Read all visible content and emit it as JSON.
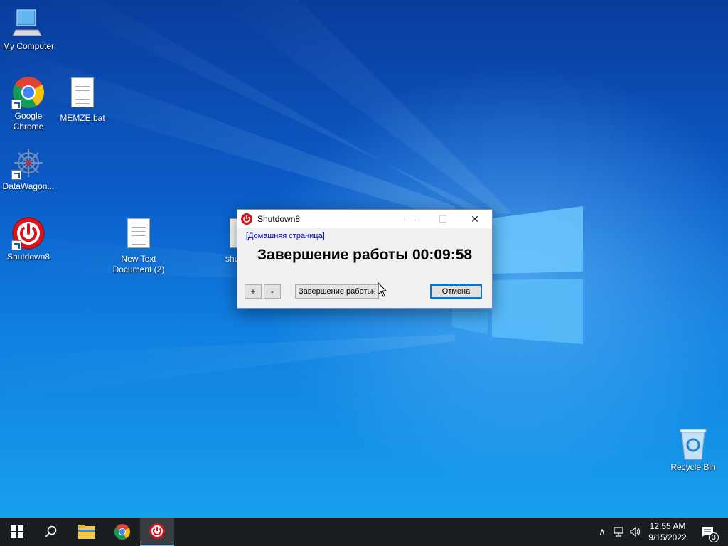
{
  "desktop": {
    "icons": [
      {
        "label": "My Computer"
      },
      {
        "label": "Google Chrome"
      },
      {
        "label": "MEMZE.bat"
      },
      {
        "label": "DataWagon..."
      },
      {
        "label": "Shutdown8"
      },
      {
        "label": "New Text Document (2)"
      },
      {
        "label": "shu"
      },
      {
        "label": "Recycle Bin"
      }
    ]
  },
  "window": {
    "title": "Shutdown8",
    "home_link": "[Домашняя страница]",
    "countdown": "Завершение работы 00:09:58",
    "plus_label": "+",
    "minus_label": "-",
    "action_selected": "Завершение работы",
    "cancel_label": "Отмена",
    "minimize_glyph": "—",
    "maximize_glyph": "☐",
    "close_glyph": "✕"
  },
  "taskbar": {
    "items": [
      "start",
      "search",
      "file-explorer",
      "chrome",
      "shutdown8"
    ],
    "active_item": "shutdown8",
    "time": "12:55 AM",
    "date": "9/15/2022",
    "notification_count": "3",
    "tray_chevron": "∧"
  },
  "colors": {
    "accent": "#0078d7",
    "shutdown_red": "#d7141a",
    "link_blue": "#0000cc"
  }
}
